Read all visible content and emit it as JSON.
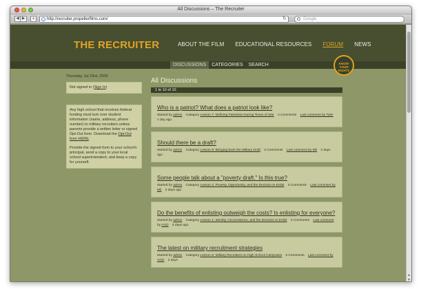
{
  "browser": {
    "title": "All Discussions – The Recruiter",
    "back": "◀",
    "forward": "▶",
    "plus": "+",
    "url": "http://recruiter.propellerfilms.com/",
    "search_placeholder": "Google"
  },
  "site": {
    "logo": "THE RECRUITER",
    "nav": [
      "ABOUT THE FILM",
      "EDUCATIONAL RESOURCES",
      "FORUM",
      "NEWS"
    ],
    "subnav": [
      "DISCUSSIONS",
      "CATEGORIES",
      "SEARCH"
    ],
    "badge": [
      "KNOW",
      "YOUR",
      "RIGHTS"
    ]
  },
  "sidebar": {
    "date": "Thursday, Jul 23rd, 2009",
    "signin_text": "Not signed in (",
    "signin_link": "Sign In",
    "signin_end": ")",
    "note_1": "Any high school that receives federal funding must turn over student information (name, address, phone number) to military recruiters unless parents provide a written letter or signed Opt-Out form. Download the ",
    "note_link": "Opt-Out form HERE",
    "note_2": "Provide the signed form to your school's principal, send a copy to your local school superintendent, and keep a copy for yourself."
  },
  "main": {
    "title": "All Discussions",
    "results": "1 to 10 of 10",
    "discussions": [
      {
        "title": "Who is a patriot? What does a patriot look like?",
        "started_by": "Started by",
        "author": "admin",
        "category_label": "Category",
        "category": "Lesson 7: Defining Patriotism During Times of War",
        "comments": "4 Comments",
        "last_label": "Last comment by",
        "last_by": "Tyler",
        "time": "1 day ago"
      },
      {
        "title": "Should there be a draft?",
        "started_by": "Started by",
        "author": "admin",
        "category_label": "Category",
        "category": "Lesson 9: Bringing back the Military Draft",
        "comments": "2 Comments",
        "last_label": "Last comment by",
        "last_by": "Mk",
        "time": "2 days ago"
      },
      {
        "title": "Some people talk about a \"poverty draft.\" Is this true?",
        "started_by": "Started by",
        "author": "admin",
        "category_label": "Category",
        "category": "Lesson 2: Poverty, Opportunity, and the Decision to Enlist",
        "comments": "3 Comments",
        "last_label": "Last comment by",
        "last_by": "Mk",
        "time": "2 days ago"
      },
      {
        "title": "Do the benefits of enlisting outweigh the costs? Is enlisting for everyone?",
        "started_by": "Started by",
        "author": "admin",
        "category_label": "Category",
        "category": "Lesson 1: Identity, Circumstance, and the Decision to Enlist",
        "comments": "2 Comments",
        "last_label": "Last comment",
        "last_by_prefix": "by",
        "last_by": "AGD",
        "time": "2 days ago"
      },
      {
        "title": "The latest on military recruitment strategies",
        "started_by": "Started by",
        "author": "admin",
        "category_label": "Category",
        "category": "Lesson 6: Military Recruiters on High School Campuses",
        "comments": "2 Comments",
        "last_label": "Last comment by",
        "last_by": "AGD",
        "time": "2 days"
      }
    ]
  }
}
